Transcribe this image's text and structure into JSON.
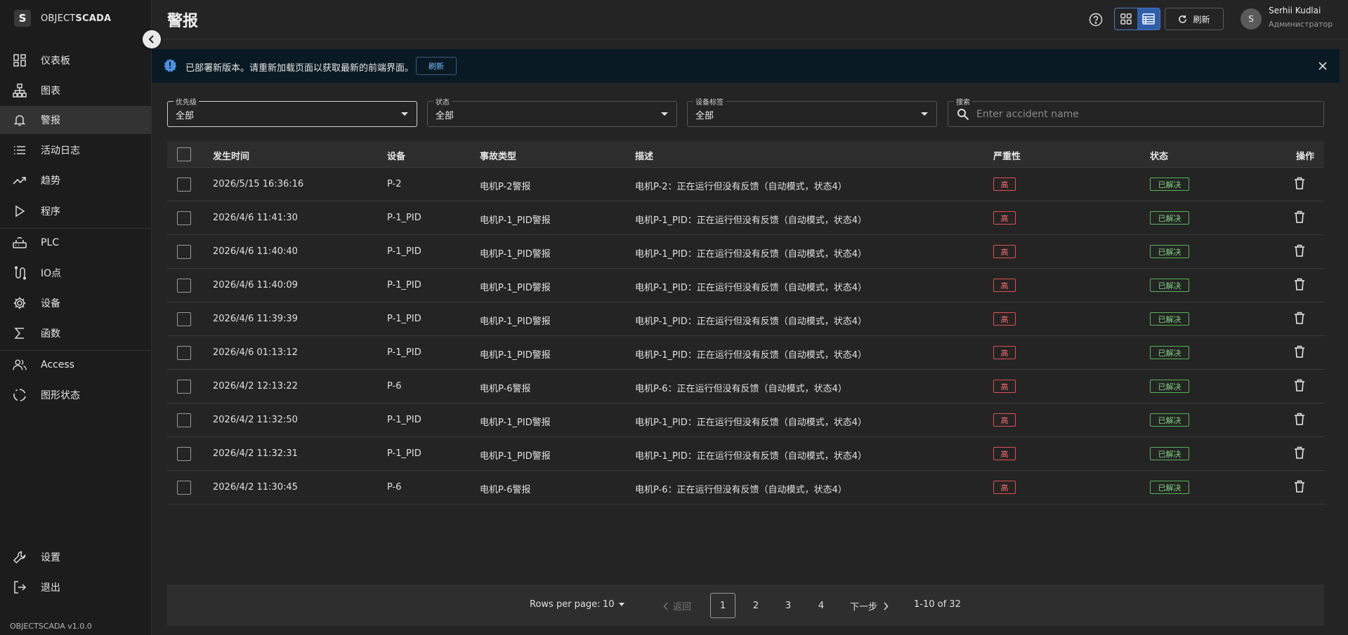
{
  "brand": {
    "logo_letter": "S",
    "name_prefix": "OBJECT",
    "name_suffix": "SCADA"
  },
  "sidebar": {
    "items": [
      {
        "label": "仪表板",
        "icon": "dashboard-icon"
      },
      {
        "label": "图表",
        "icon": "diagram-icon"
      },
      {
        "label": "警报",
        "icon": "bell-icon",
        "active": true
      },
      {
        "label": "活动日志",
        "icon": "list-icon"
      },
      {
        "label": "趋势",
        "icon": "trend-icon"
      },
      {
        "label": "程序",
        "icon": "play-icon"
      },
      {
        "label": "PLC",
        "icon": "plc-icon"
      },
      {
        "label": "IO点",
        "icon": "io-icon"
      },
      {
        "label": "设备",
        "icon": "gear-icon"
      },
      {
        "label": "函数",
        "icon": "sigma-icon"
      },
      {
        "label": "Access",
        "icon": "users-icon"
      },
      {
        "label": "图形状态",
        "icon": "cycle-icon"
      }
    ],
    "bottom_items": [
      {
        "label": "设置",
        "icon": "wrench-icon"
      },
      {
        "label": "退出",
        "icon": "logout-icon"
      }
    ],
    "version": "OBJECTSCADA v1.0.0"
  },
  "header": {
    "title": "警报",
    "refresh_label": "刷新",
    "user_initial": "S",
    "user_name": "Serhii Kudlai",
    "user_role": "Администратор"
  },
  "banner": {
    "text": "已部署新版本。请重新加载页面以获取最新的前端界面。",
    "button_label": "刷新"
  },
  "filters": {
    "priority": {
      "label": "优先级",
      "value": "全部"
    },
    "status": {
      "label": "状态",
      "value": "全部"
    },
    "device_tag": {
      "label": "设备标签",
      "value": "全部"
    },
    "search": {
      "label": "搜索",
      "placeholder": "Enter accident name"
    }
  },
  "table": {
    "columns": [
      "发生时间",
      "设备",
      "事故类型",
      "描述",
      "严重性",
      "状态",
      "操作"
    ],
    "rows": [
      {
        "time": "2026/5/15 16:36:16",
        "device": "P-2",
        "type": "电机P-2警报",
        "desc": "电机P-2：正在运行但没有反馈（自动模式，状态4）",
        "severity": "高",
        "status": "已解决"
      },
      {
        "time": "2026/4/6 11:41:30",
        "device": "P-1_PID",
        "type": "电机P-1_PID警报",
        "desc": "电机P-1_PID：正在运行但没有反馈（自动模式，状态4）",
        "severity": "高",
        "status": "已解决"
      },
      {
        "time": "2026/4/6 11:40:40",
        "device": "P-1_PID",
        "type": "电机P-1_PID警报",
        "desc": "电机P-1_PID：正在运行但没有反馈（自动模式，状态4）",
        "severity": "高",
        "status": "已解决"
      },
      {
        "time": "2026/4/6 11:40:09",
        "device": "P-1_PID",
        "type": "电机P-1_PID警报",
        "desc": "电机P-1_PID：正在运行但没有反馈（自动模式，状态4）",
        "severity": "高",
        "status": "已解决"
      },
      {
        "time": "2026/4/6 11:39:39",
        "device": "P-1_PID",
        "type": "电机P-1_PID警报",
        "desc": "电机P-1_PID：正在运行但没有反馈（自动模式，状态4）",
        "severity": "高",
        "status": "已解决"
      },
      {
        "time": "2026/4/6 01:13:12",
        "device": "P-1_PID",
        "type": "电机P-1_PID警报",
        "desc": "电机P-1_PID：正在运行但没有反馈（自动模式，状态4）",
        "severity": "高",
        "status": "已解决"
      },
      {
        "time": "2026/4/2 12:13:22",
        "device": "P-6",
        "type": "电机P-6警报",
        "desc": "电机P-6：正在运行但没有反馈（自动模式，状态4）",
        "severity": "高",
        "status": "已解决"
      },
      {
        "time": "2026/4/2 11:32:50",
        "device": "P-1_PID",
        "type": "电机P-1_PID警报",
        "desc": "电机P-1_PID：正在运行但没有反馈（自动模式，状态4）",
        "severity": "高",
        "status": "已解决"
      },
      {
        "time": "2026/4/2 11:32:31",
        "device": "P-1_PID",
        "type": "电机P-1_PID警报",
        "desc": "电机P-1_PID：正在运行但没有反馈（自动模式，状态4）",
        "severity": "高",
        "status": "已解决"
      },
      {
        "time": "2026/4/2 11:30:45",
        "device": "P-6",
        "type": "电机P-6警报",
        "desc": "电机P-6：正在运行但没有反馈（自动模式，状态4）",
        "severity": "高",
        "status": "已解决"
      }
    ]
  },
  "pagination": {
    "rows_per_page_label": "Rows per page:",
    "rows_per_page": "10",
    "prev_label": "返回",
    "next_label": "下一步",
    "pages": [
      "1",
      "2",
      "3",
      "4"
    ],
    "current_page": "1",
    "range": "1-10 of 32"
  },
  "colors": {
    "accent": "#2f5ea8",
    "severity_high": "#e05050",
    "status_resolved": "#56b356",
    "banner_bg": "#0a1a24"
  }
}
